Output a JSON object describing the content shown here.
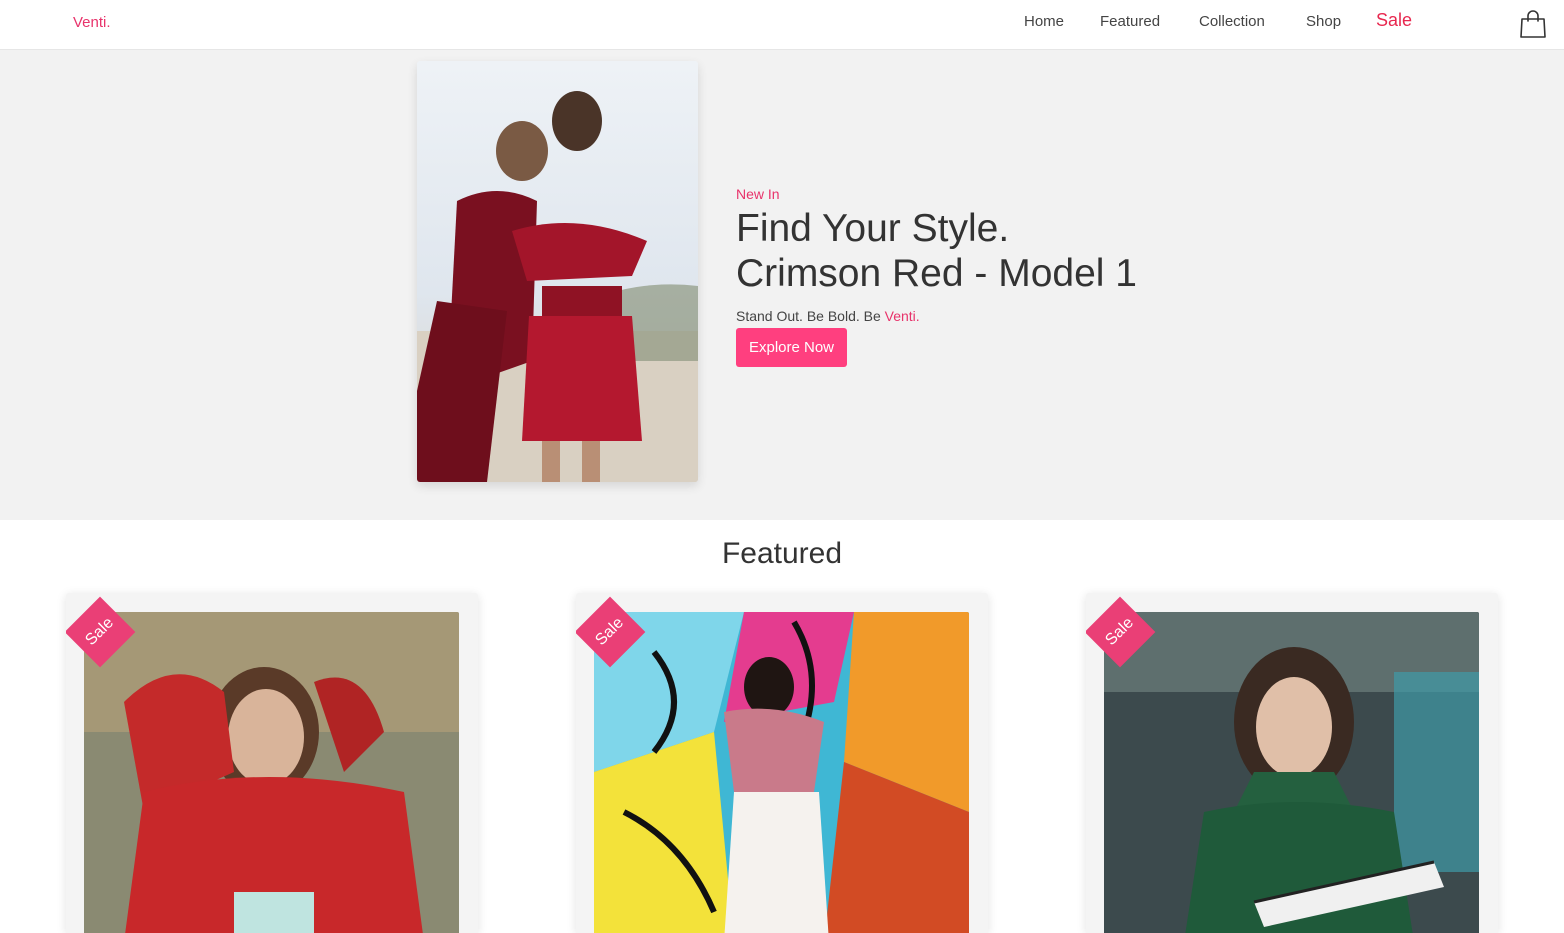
{
  "nav": {
    "brand": "Venti.",
    "items": [
      "Home",
      "Featured",
      "Collection",
      "Shop"
    ],
    "sale": "Sale",
    "cart_icon": "shopping-bag-icon"
  },
  "hero": {
    "kicker": "New In",
    "headline_line1": "Find Your Style.",
    "headline_line2": "Crimson Red - Model 1",
    "tagline_prefix": "Stand Out. Be Bold. Be ",
    "tagline_brand": "Venti.",
    "cta_label": "Explore Now"
  },
  "featured": {
    "title": "Featured",
    "badge": "Sale"
  },
  "colors": {
    "accent": "#e8336b",
    "button": "#ff3f7f",
    "sale_link": "#e8274f",
    "hero_bg": "#f2f2f2"
  }
}
